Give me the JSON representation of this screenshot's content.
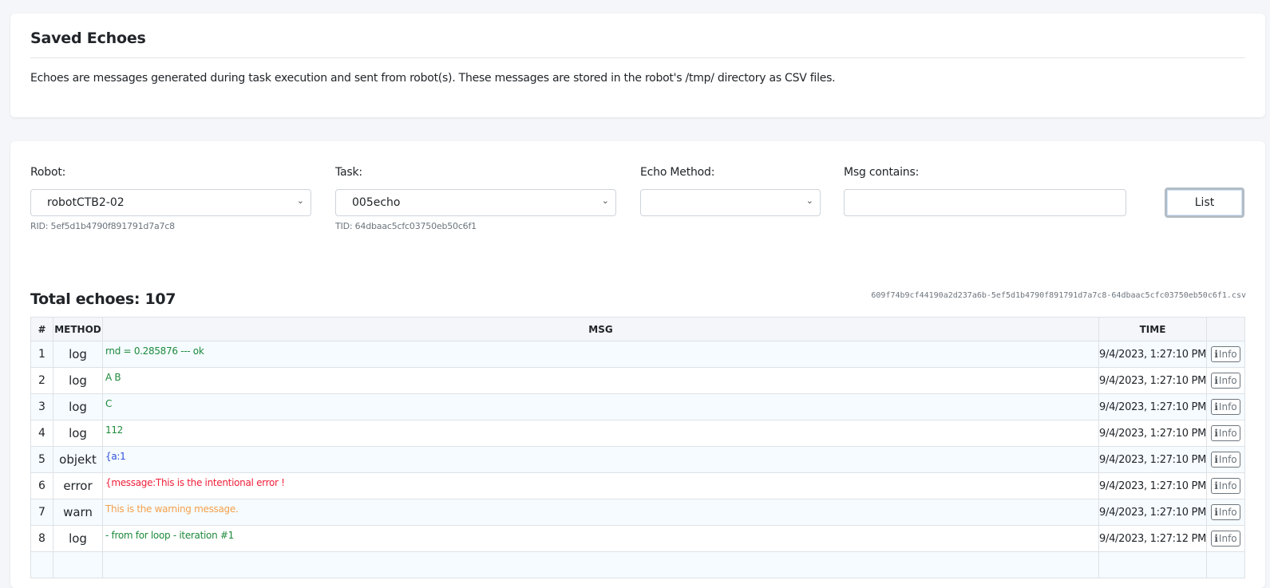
{
  "header": {
    "title": "Saved Echoes",
    "description": "Echoes are messages generated during task execution and sent from robot(s). These messages are stored in the robot's /tmp/ directory as CSV files."
  },
  "filters": {
    "robot": {
      "label": "Robot:",
      "value": "robotCTB2-02",
      "sub": "RID: 5ef5d1b4790f891791d7a7c8"
    },
    "task": {
      "label": "Task:",
      "value": "005echo",
      "sub": "TID: 64dbaac5cfc03750eb50c6f1"
    },
    "echo_method": {
      "label": "Echo Method:",
      "value": ""
    },
    "msg_contains": {
      "label": "Msg contains:",
      "value": "",
      "placeholder": ""
    },
    "list_button": "List"
  },
  "results": {
    "total_label": "Total echoes: 107",
    "csv_file": "609f74b9cf44190a2d237a6b-5ef5d1b4790f891791d7a7c8-64dbaac5cfc03750eb50c6f1.csv",
    "columns": [
      "#",
      "METHOD",
      "MSG",
      "TIME",
      ""
    ],
    "info_label": "Info",
    "method_colors": {
      "log": "#1e8a3c",
      "objekt": "#2f4fd8",
      "error": "#f0203a",
      "warn": "#f5a04a"
    },
    "rows": [
      {
        "num": "1",
        "method": "log",
        "msg": "rnd = 0.285876 --- ok",
        "time": "9/4/2023, 1:27:10 PM"
      },
      {
        "num": "2",
        "method": "log",
        "msg": "A B",
        "time": "9/4/2023, 1:27:10 PM"
      },
      {
        "num": "3",
        "method": "log",
        "msg": "C",
        "time": "9/4/2023, 1:27:10 PM"
      },
      {
        "num": "4",
        "method": "log",
        "msg": "112",
        "time": "9/4/2023, 1:27:10 PM"
      },
      {
        "num": "5",
        "method": "objekt",
        "msg": "{a:1",
        "time": "9/4/2023, 1:27:10 PM"
      },
      {
        "num": "6",
        "method": "error",
        "msg": "{message:This is the intentional error !",
        "time": "9/4/2023, 1:27:10 PM"
      },
      {
        "num": "7",
        "method": "warn",
        "msg": "This is the warning message.",
        "time": "9/4/2023, 1:27:10 PM"
      },
      {
        "num": "8",
        "method": "log",
        "msg": "- from for loop - iteration #1",
        "time": "9/4/2023, 1:27:12 PM"
      },
      {
        "num": "",
        "method": "",
        "msg": "",
        "time": ""
      }
    ]
  }
}
